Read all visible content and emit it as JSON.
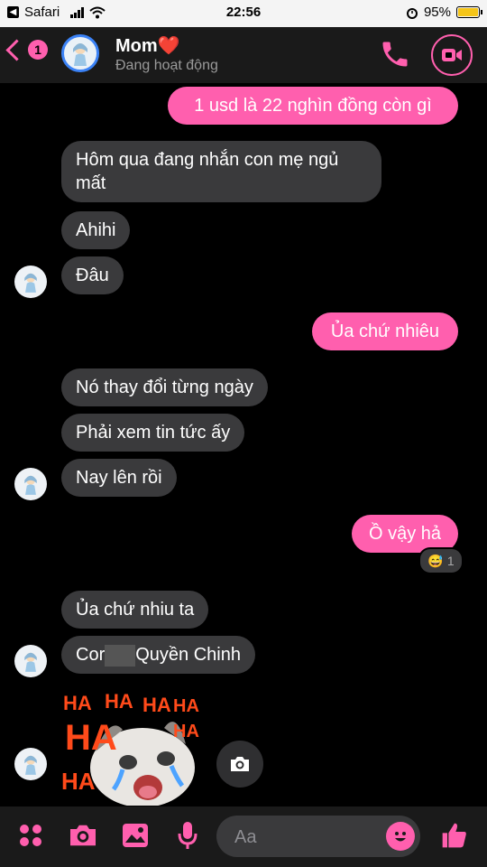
{
  "status_bar": {
    "back_app": "Safari",
    "time": "22:56",
    "battery": "95%"
  },
  "header": {
    "back_count": "1",
    "name": "Mom",
    "heart": "❤️",
    "status": "Đang hoạt động",
    "accent": "#ff5fae"
  },
  "messages": [
    {
      "dir": "out",
      "text": "1 usd là 22 nghìn đồng còn gì"
    },
    {
      "dir": "in",
      "text": "Hôm qua đang nhắn con mẹ ngủ mất"
    },
    {
      "dir": "in",
      "text": "Ahihi"
    },
    {
      "dir": "in",
      "text": "Đâu"
    },
    {
      "dir": "out",
      "text": "Ủa chứ nhiêu"
    },
    {
      "dir": "in",
      "text": "Nó thay đổi từng ngày"
    },
    {
      "dir": "in",
      "text": "Phải xem tin tức ấy"
    },
    {
      "dir": "in",
      "text": "Nay lên rồi"
    },
    {
      "dir": "out",
      "text": "Ồ vậy hả"
    },
    {
      "dir": "in",
      "text": "Ủa chứ nhiu ta"
    },
    {
      "dir": "in",
      "text_before": "Cor",
      "text_after": "Quyền Chinh"
    }
  ],
  "reaction": {
    "emoji": "😅",
    "count": "1"
  },
  "sticker": {
    "text": "HA"
  },
  "composer": {
    "placeholder": "Aa"
  }
}
